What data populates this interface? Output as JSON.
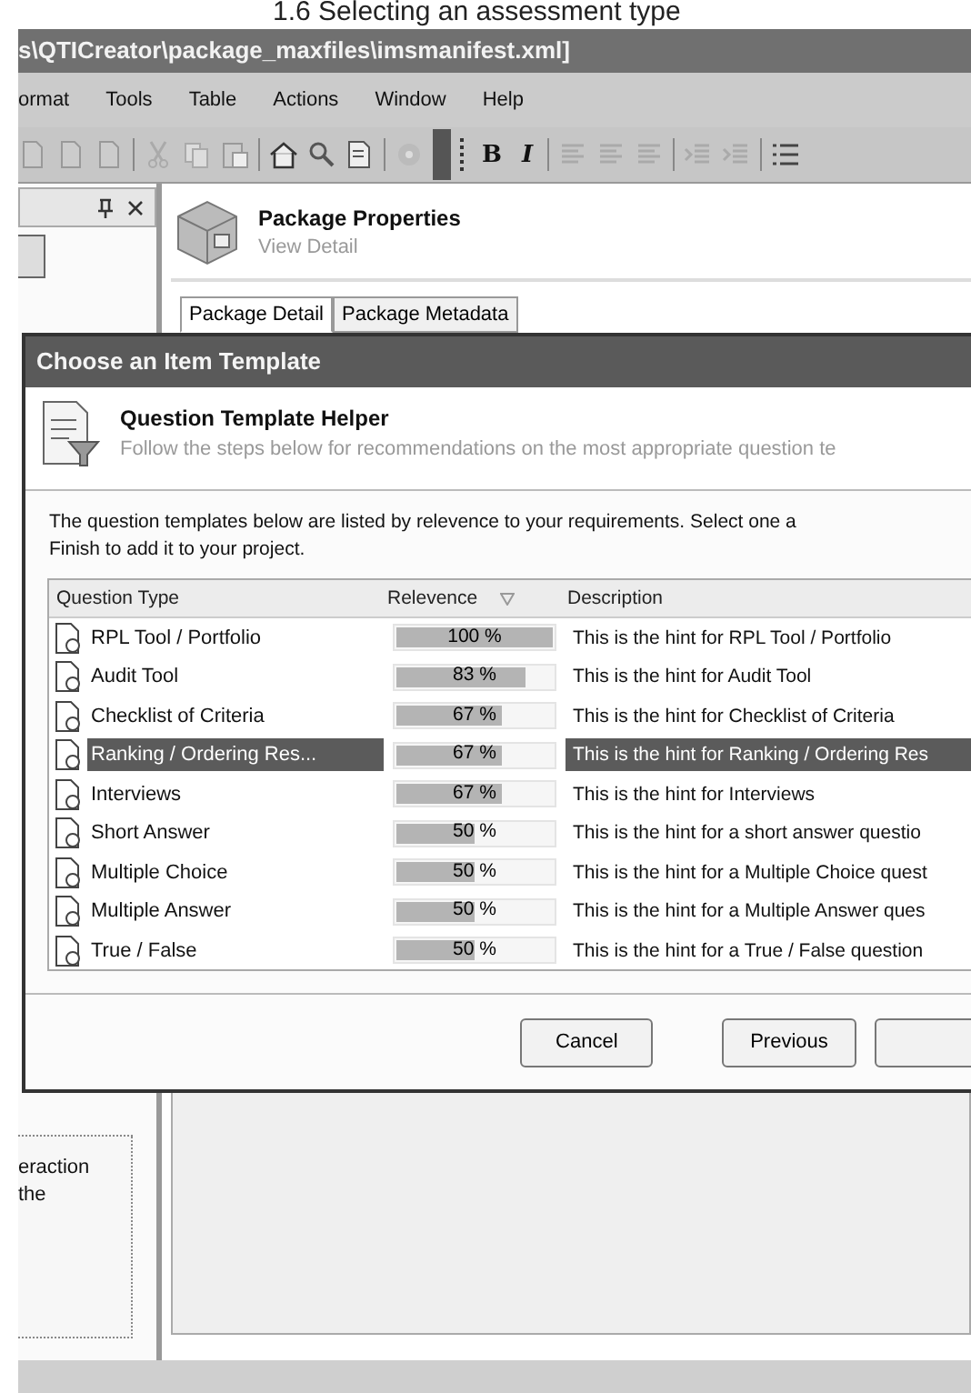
{
  "document_caption": "1.6 Selecting an assessment type",
  "window": {
    "title": "s\\QTICreator\\package_maxfiles\\imsmanifest.xml]"
  },
  "menu": [
    "ormat",
    "Tools",
    "Table",
    "Actions",
    "Window",
    "Help"
  ],
  "toolbar": {
    "format_buttons": [
      {
        "label": "B",
        "kind": "bold"
      },
      {
        "label": "I",
        "kind": "italic"
      }
    ]
  },
  "side_panel": {
    "note_lines": [
      "eraction",
      "the"
    ]
  },
  "package": {
    "title": "Package Properties",
    "subtitle": "View Detail",
    "tabs": [
      {
        "label": "Package Detail",
        "selected": true
      },
      {
        "label": "Package Metadata",
        "selected": false
      }
    ]
  },
  "dialog": {
    "title": "Choose an Item Template",
    "header": {
      "title": "Question Template Helper",
      "subtitle": "Follow the steps below for recommendations on the most appropriate question te"
    },
    "intro": [
      "The question templates below are listed by relevence to your requirements.  Select one a",
      "Finish to add it to your project."
    ],
    "columns": [
      "Question Type",
      "Relevence",
      "Description"
    ],
    "rows": [
      {
        "name": "RPL Tool / Portfolio",
        "relevance": "100 %",
        "level": 1,
        "hint": "This is the hint for RPL Tool / Portfolio",
        "selected": false
      },
      {
        "name": "Audit Tool",
        "relevance": "83 %",
        "level": 0.83,
        "hint": "This is the hint for Audit Tool",
        "selected": false
      },
      {
        "name": "Checklist of Criteria",
        "relevance": "67 %",
        "level": 0.67,
        "hint": "This is the hint for Checklist of Criteria",
        "selected": false
      },
      {
        "name": "Ranking / Ordering Res...",
        "relevance": "67 %",
        "level": 0.67,
        "hint": "This is the hint for Ranking / Ordering Res",
        "selected": true
      },
      {
        "name": "Interviews",
        "relevance": "67 %",
        "level": 0.67,
        "hint": "This is the hint for Interviews",
        "selected": false
      },
      {
        "name": "Short Answer",
        "relevance": "50 %",
        "level": 0.5,
        "hint": "This is the hint for a short answer questio",
        "selected": false
      },
      {
        "name": "Multiple Choice",
        "relevance": "50 %",
        "level": 0.5,
        "hint": "This is the hint for a Multiple Choice quest",
        "selected": false
      },
      {
        "name": "Multiple Answer",
        "relevance": "50 %",
        "level": 0.5,
        "hint": "This is the hint for a Multiple Answer ques",
        "selected": false
      },
      {
        "name": "True / False",
        "relevance": "50 %",
        "level": 0.5,
        "hint": "This is the hint for a True / False question",
        "selected": false
      }
    ],
    "buttons": [
      "Cancel",
      "Previous"
    ]
  }
}
